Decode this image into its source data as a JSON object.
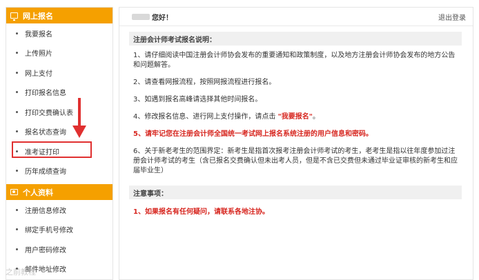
{
  "sidebar": {
    "section1": {
      "title": "网上报名",
      "items": [
        {
          "label": "我要报名"
        },
        {
          "label": "上传照片"
        },
        {
          "label": "网上支付"
        },
        {
          "label": "打印报名信息"
        },
        {
          "label": "打印交费确认表"
        },
        {
          "label": "报名状态查询"
        },
        {
          "label": "准考证打印"
        },
        {
          "label": "历年成绩查询"
        }
      ]
    },
    "section2": {
      "title": "个人资料",
      "items": [
        {
          "label": "注册信息修改"
        },
        {
          "label": "绑定手机号修改"
        },
        {
          "label": "用户密码修改"
        },
        {
          "label": "邮件地址修改"
        }
      ]
    }
  },
  "header": {
    "greeting": "您好！",
    "logout": "退出登录"
  },
  "main": {
    "instructions_title": "注册会计师考试报名说明：",
    "notes": [
      "1、请仔细阅读中国注册会计师协会发布的重要通知和政策制度，以及地方注册会计师协会发布的地方公告和问题解答。",
      "2、请查看网报流程，按照网报流程进行报名。",
      "3、如遇到报名高峰请选择其他时间报名。",
      "4、修改报名信息、进行网上支付操作，请点击",
      "5、请牢记您在注册会计师全国统一考试网上报名系统注册的用户信息和密码。",
      "6、关于新老考生的范围界定：新考生是指首次报考注册会计师考试的考生，老考生是指以往年度参加过注册会计师考试的考生（含已报名交费确认但未出考人员，但是不含已交费但未通过毕业证审核的新考生和应届毕业生）"
    ],
    "note4_link": "\"我要报名\"",
    "note4_end": "。",
    "attention_title": "注意事项：",
    "attention_item": "1、如果报名有任何疑问，请联系各地注协。"
  },
  "watermark": "之前教程",
  "colors": {
    "header_orange": "#f5a000",
    "alert_red": "#d7261f",
    "highlight_red": "#e03030"
  }
}
